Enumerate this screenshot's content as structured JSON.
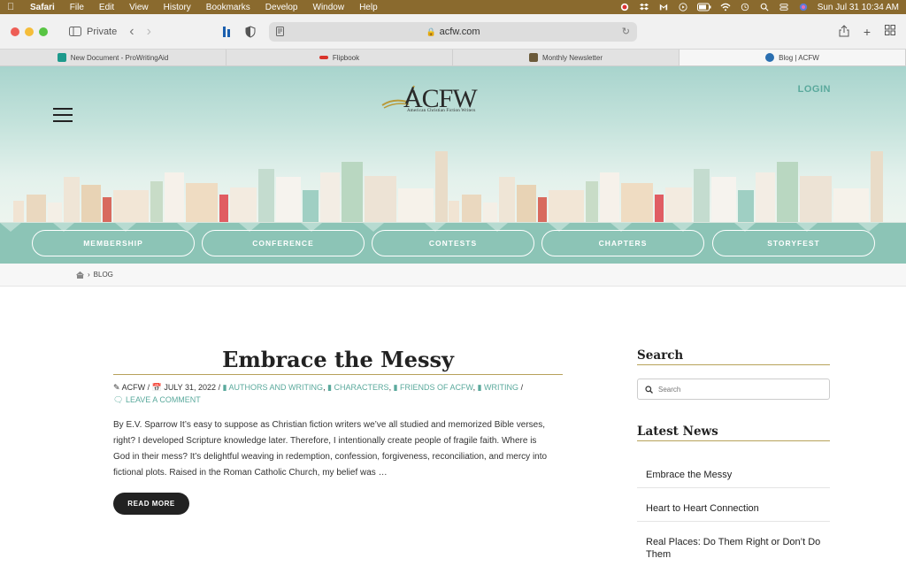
{
  "menubar": {
    "app": "Safari",
    "items": [
      "File",
      "Edit",
      "View",
      "History",
      "Bookmarks",
      "Develop",
      "Window",
      "Help"
    ],
    "clock": "Sun Jul 31  10:34 AM"
  },
  "browser": {
    "mode_label": "Private",
    "url": "acfw.com",
    "tabs": [
      {
        "label": "New Document - ProWritingAid",
        "favicon_color": "#1d9a8c"
      },
      {
        "label": "Flipbook",
        "favicon_color": "#d9342b"
      },
      {
        "label": "Monthly Newsletter",
        "favicon_color": "#6b5a3a"
      },
      {
        "label": "Blog | ACFW",
        "favicon_color": "#2a6fb0",
        "active": true
      }
    ]
  },
  "site": {
    "logo_text": "ACFW",
    "logo_subtitle": "American Christian Fiction Writers",
    "login_label": "LOGIN",
    "nav": [
      "MEMBERSHIP",
      "CONFERENCE",
      "CONTESTS",
      "CHAPTERS",
      "STORYFEST"
    ],
    "breadcrumb": "BLOG"
  },
  "post": {
    "title": "Embrace the Messy",
    "author": "ACFW",
    "date": "JULY 31, 2022",
    "categories": [
      "AUTHORS AND WRITING",
      "CHARACTERS",
      "FRIENDS OF ACFW",
      "WRITING"
    ],
    "comment_label": "LEAVE A COMMENT",
    "excerpt": "By E.V. Sparrow It’s easy to suppose as Christian fiction writers we’ve all studied and memorized Bible verses, right? I developed Scripture knowledge later. Therefore, I intentionally create people of fragile faith. Where is God in their mess? It’s delightful weaving in redemption, confession, forgiveness, reconciliation, and mercy into fictional plots. Raised in the Roman Catholic Church, my belief was …",
    "read_more": "READ MORE"
  },
  "sidebar": {
    "search_heading": "Search",
    "search_placeholder": "Search",
    "news_heading": "Latest News",
    "news": [
      "Embrace the Messy",
      "Heart to Heart Connection",
      "Real Places: Do Them Right or Don’t Do Them"
    ]
  },
  "colors": {
    "menubar": "#8a6a2e",
    "teal": "#8cc4b6",
    "teal_text": "#5aa99c",
    "gold_rule": "#b7a25a"
  }
}
